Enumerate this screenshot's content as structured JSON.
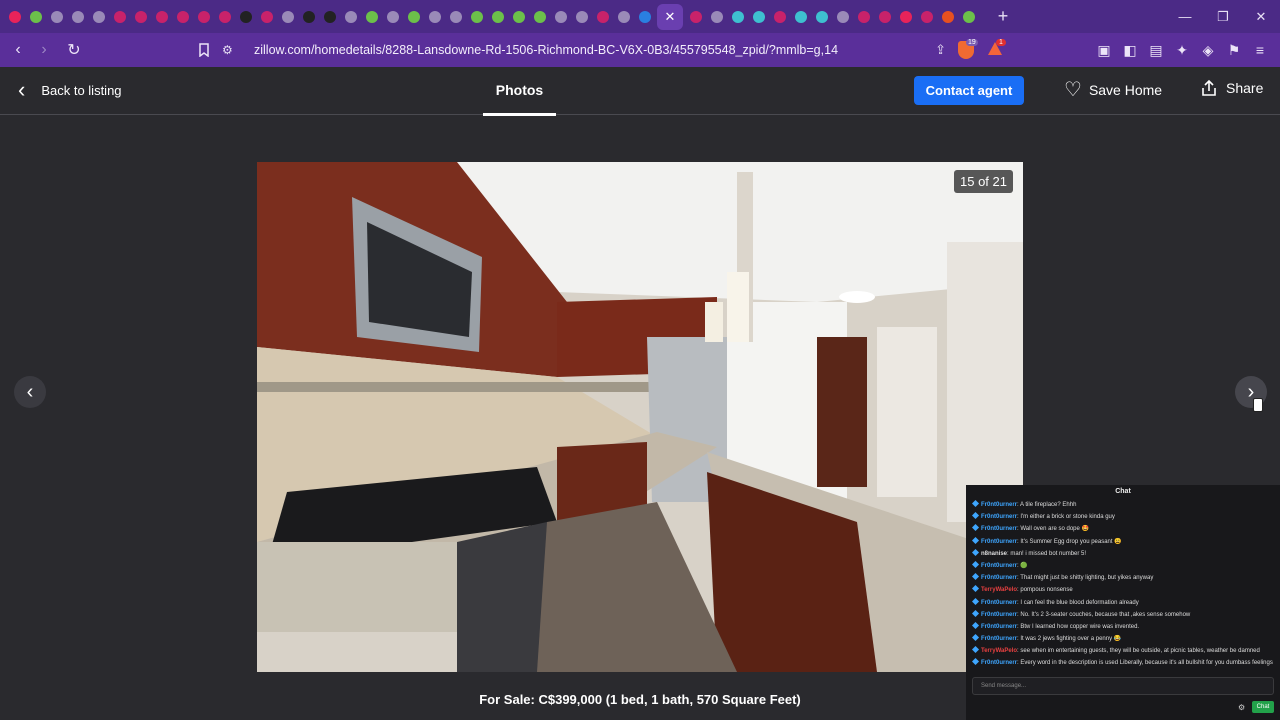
{
  "browser": {
    "tab_favicon_colors": [
      "#e8235a",
      "#6cc04a",
      "#9a8ab8",
      "#9a8ab8",
      "#9a8ab8",
      "#c8226a",
      "#c8226a",
      "#c8226a",
      "#c8226a",
      "#c8226a",
      "#c8226a",
      "#222222",
      "#c8226a",
      "#9a8ab8",
      "#222222",
      "#222222",
      "#9a8ab8",
      "#6cc04a",
      "#9a8ab8",
      "#6cc04a",
      "#9a8ab8",
      "#9a8ab8",
      "#6cc04a",
      "#6cc04a",
      "#6cc04a",
      "#6cc04a",
      "#9a8ab8",
      "#9a8ab8",
      "#c8226a",
      "#9a8ab8",
      "#2a7fe0"
    ],
    "active_tab_close": "✕",
    "tab_favicon_colors_after": [
      "#c8226a",
      "#9a8ab8",
      "#3ec0d0",
      "#3ec0d0",
      "#c8226a",
      "#3ec0d0",
      "#3ec0d0",
      "#9a8ab8",
      "#c8226a",
      "#c8226a",
      "#e8235a",
      "#c8226a",
      "#e85020",
      "#6cc04a"
    ],
    "new_tab": "+",
    "url": "zillow.com/homedetails/8288-Lansdowne-Rd-1506-Richmond-BC-V6X-0B3/455795548_zpid/?mmlb=g,14",
    "shield_count": "19",
    "rewards_count": "1"
  },
  "header": {
    "back_label": "Back to listing",
    "photos_tab": "Photos",
    "contact_label": "Contact agent",
    "save_label": "Save Home",
    "share_label": "Share"
  },
  "gallery": {
    "counter": "15 of 21",
    "caption": "For Sale: C$399,000 (1 bed, 1 bath, 570 Square Feet)"
  },
  "chat": {
    "title": "Chat",
    "placeholder": "Send message...",
    "send_label": "Chat",
    "messages": [
      {
        "user": "Fr0nt0urnerr",
        "color": "#3ea6ff",
        "text": "A tile fireplace? Ehhh"
      },
      {
        "user": "Fr0nt0urnerr",
        "color": "#3ea6ff",
        "text": "I'm either a brick or stone kinda guy"
      },
      {
        "user": "Fr0nt0urnerr",
        "color": "#3ea6ff",
        "text": "Wall oven are so dope 🤩"
      },
      {
        "user": "Fr0nt0urnerr",
        "color": "#3ea6ff",
        "text": "It's Summer Egg drop you peasant 😩"
      },
      {
        "user": "n8nanise",
        "color": "#dddddd",
        "text": "man! i missed bot number 5!"
      },
      {
        "user": "Fr0nt0urnerr",
        "color": "#3ea6ff",
        "text": "🟢"
      },
      {
        "user": "Fr0nt0urnerr",
        "color": "#3ea6ff",
        "text": "That might just be shitty lighting, but yikes anyway"
      },
      {
        "user": "TerryWaPelo",
        "color": "#e84040",
        "text": "pompous nonsense"
      },
      {
        "user": "Fr0nt0urnerr",
        "color": "#3ea6ff",
        "text": "I can feel the blue blood deformation already"
      },
      {
        "user": "Fr0nt0urnerr",
        "color": "#3ea6ff",
        "text": "No. It's 2 3-seater couches, because that ,akes sense somehow"
      },
      {
        "user": "Fr0nt0urnerr",
        "color": "#3ea6ff",
        "text": "Btw I learned how copper wire was invented."
      },
      {
        "user": "Fr0nt0urnerr",
        "color": "#3ea6ff",
        "text": "It was 2 jews fighting over a penny 😂"
      },
      {
        "user": "TerryWaPelo",
        "color": "#e84040",
        "text": "see when im entertaining guests, they will be outside, at picnic tables, weather be damned"
      },
      {
        "user": "Fr0nt0urnerr",
        "color": "#3ea6ff",
        "text": "Every word in the description is used Liberally, because it's all bullshit for you dumbass feelings"
      }
    ]
  }
}
